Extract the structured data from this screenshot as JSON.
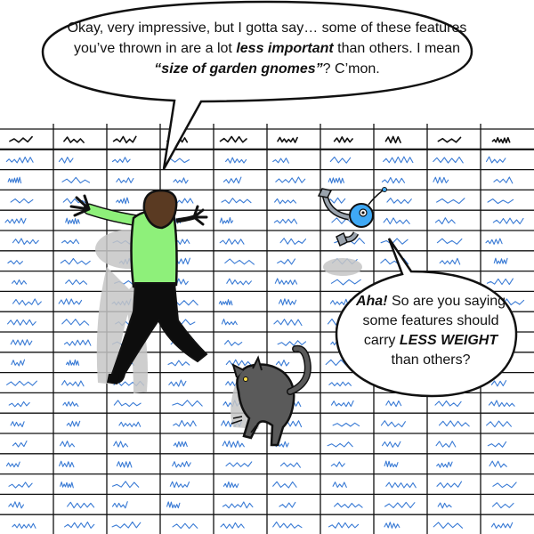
{
  "speech_top": {
    "segments": [
      {
        "text": "Okay, very impressive, but I gotta say… some of these features you’ve thrown in are a lot ",
        "style": "normal"
      },
      {
        "text": "less important",
        "style": "bold-italic"
      },
      {
        "text": " than others. I mean ",
        "style": "normal"
      },
      {
        "text": "“size of garden gnomes”",
        "style": "bold-italic"
      },
      {
        "text": "? C’mon.",
        "style": "normal"
      }
    ]
  },
  "speech_right": {
    "segments": [
      {
        "text": "Aha!",
        "style": "bold-italic"
      },
      {
        "text": " So are you saying some features should carry ",
        "style": "normal"
      },
      {
        "text": "LESS WEIGHT",
        "style": "bold-italic"
      },
      {
        "text": " than others?",
        "style": "normal"
      }
    ]
  },
  "colors": {
    "ink": "#111111",
    "grid_text": "#3a7bd5",
    "shirt": "#8ef07a",
    "hair": "#5a3a22",
    "pants": "#0d0d0d",
    "skin": "#f3ddd0",
    "cat": "#5a5a5a",
    "robot": "#3fa9f5",
    "robot_arm": "#9aa3ad",
    "shadow": "#c9c9c9"
  }
}
